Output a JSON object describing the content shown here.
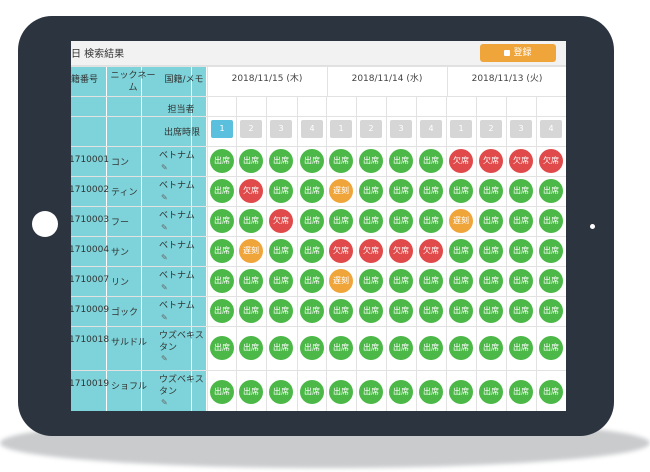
{
  "header": {
    "title": "日 検索結果",
    "register_label": "登録"
  },
  "columns": {
    "student_no": "学籍番号",
    "nickname": "ニックネーム",
    "nationality_memo": "国籍/メモ",
    "teacher": "担当者",
    "period_label": "出席時限"
  },
  "dates": [
    "2018/11/15 (木)",
    "2018/11/14 (水)",
    "2018/11/13 (火)"
  ],
  "periods": [
    "1",
    "2",
    "3",
    "4",
    "1",
    "2",
    "3",
    "4",
    "1",
    "2",
    "3",
    "4"
  ],
  "status_labels": {
    "present": "出席",
    "absent": "欠席",
    "late": "遅刻"
  },
  "status_colors": {
    "present": "#4cb848",
    "absent": "#e04a4a",
    "late": "#f0a53a",
    "accent": "#7dd3d9"
  },
  "icons": {
    "pencil": "pencil-icon",
    "save": "save-icon"
  },
  "rows": [
    {
      "id": "1710001",
      "name": "コン",
      "nationality": "ベトナム",
      "status": [
        "出席",
        "出席",
        "出席",
        "出席",
        "出席",
        "出席",
        "出席",
        "出席",
        "欠席",
        "欠席",
        "欠席",
        "欠席"
      ]
    },
    {
      "id": "1710002",
      "name": "ティン",
      "nationality": "ベトナム",
      "status": [
        "出席",
        "欠席",
        "出席",
        "出席",
        "遅刻",
        "出席",
        "出席",
        "出席",
        "出席",
        "出席",
        "出席",
        "出席"
      ]
    },
    {
      "id": "1710003",
      "name": "フー",
      "nationality": "ベトナム",
      "status": [
        "出席",
        "出席",
        "欠席",
        "出席",
        "出席",
        "出席",
        "出席",
        "出席",
        "遅刻",
        "出席",
        "出席",
        "出席"
      ]
    },
    {
      "id": "1710004",
      "name": "サン",
      "nationality": "ベトナム",
      "status": [
        "出席",
        "遅刻",
        "出席",
        "出席",
        "欠席",
        "欠席",
        "欠席",
        "欠席",
        "出席",
        "出席",
        "出席",
        "出席"
      ]
    },
    {
      "id": "1710007",
      "name": "リン",
      "nationality": "ベトナム",
      "status": [
        "出席",
        "出席",
        "出席",
        "出席",
        "遅刻",
        "出席",
        "出席",
        "出席",
        "出席",
        "出席",
        "出席",
        "出席"
      ]
    },
    {
      "id": "1710009",
      "name": "ゴック",
      "nationality": "ベトナム",
      "status": [
        "出席",
        "出席",
        "出席",
        "出席",
        "出席",
        "出席",
        "出席",
        "出席",
        "出席",
        "出席",
        "出席",
        "出席"
      ]
    },
    {
      "id": "1710018",
      "name": "サルドル",
      "nationality": "ウズベキスタン",
      "status": [
        "出席",
        "出席",
        "出席",
        "出席",
        "出席",
        "出席",
        "出席",
        "出席",
        "出席",
        "出席",
        "出席",
        "出席"
      ]
    },
    {
      "id": "1710019",
      "name": "ショフル",
      "nationality": "ウズベキスタン",
      "status": [
        "出席",
        "出席",
        "出席",
        "出席",
        "出席",
        "出席",
        "出席",
        "出席",
        "出席",
        "出席",
        "出席",
        "出席"
      ]
    }
  ]
}
